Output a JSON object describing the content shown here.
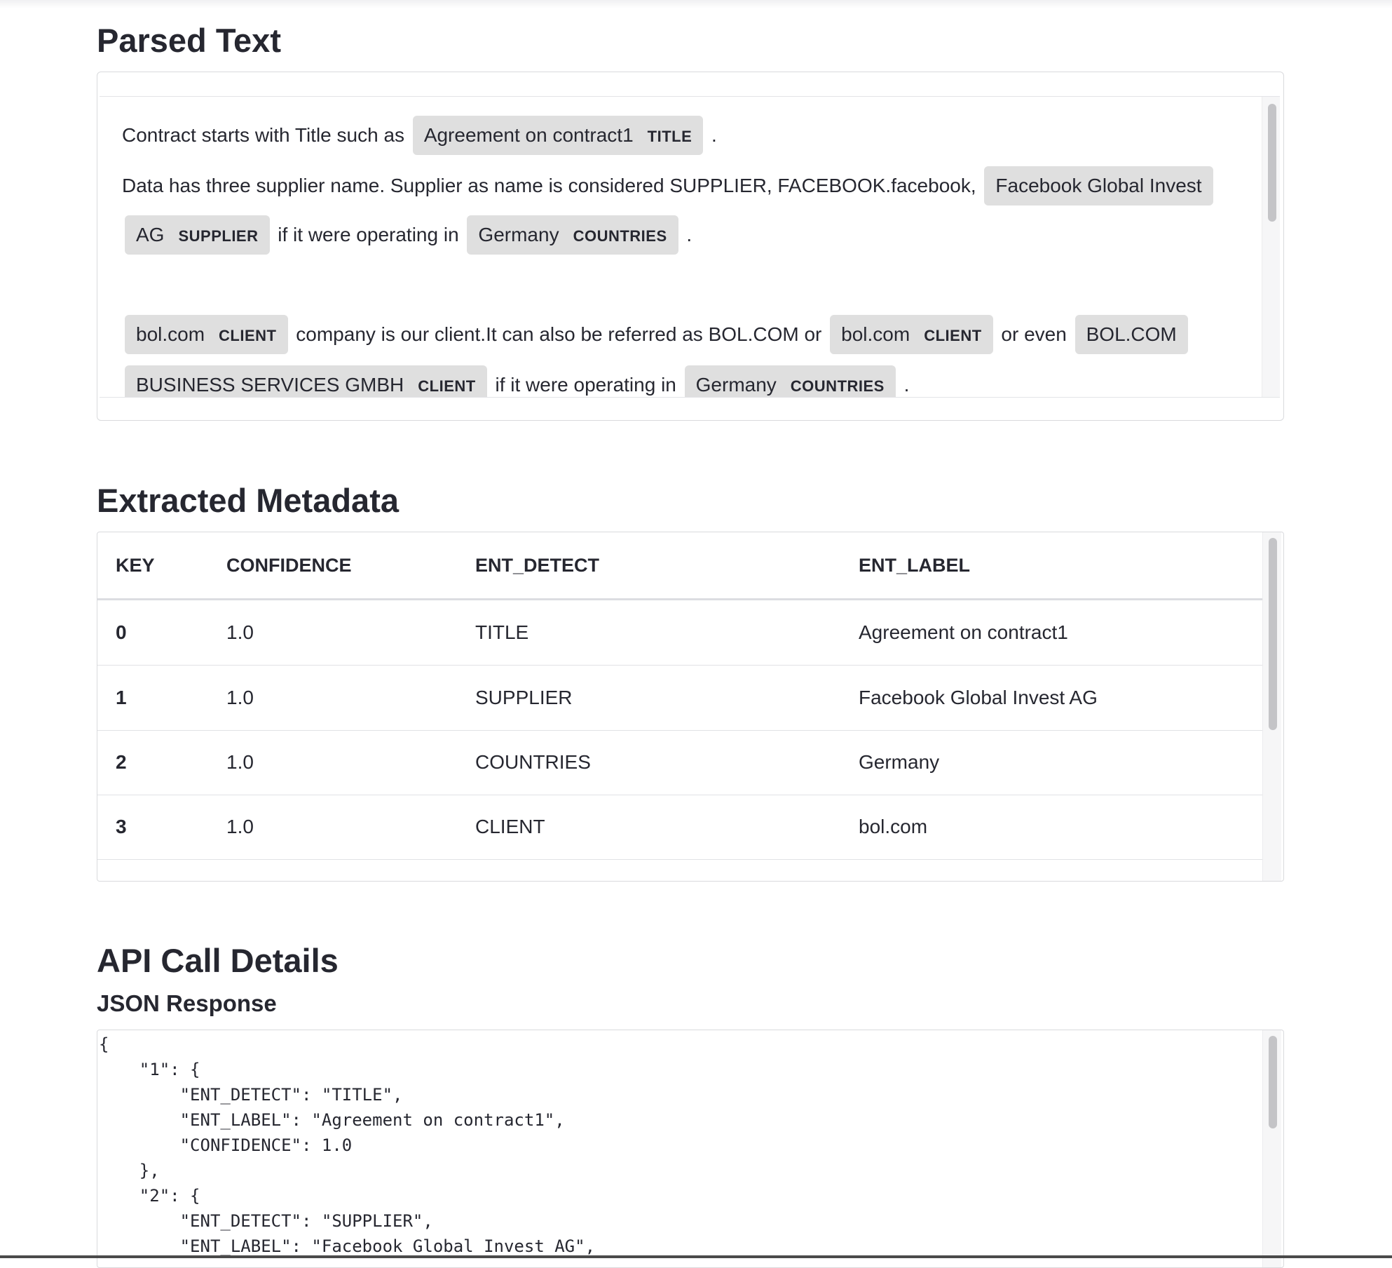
{
  "parsed_text": {
    "heading": "Parsed Text",
    "p1_text": "Contract starts with Title such as ",
    "p1_ent_text": "Agreement on contract1",
    "p1_ent_label": "TITLE",
    "p1_end": " .",
    "p2_text": "Data has three supplier name. Supplier as name is considered SUPPLIER, FACEBOOK.facebook, ",
    "p2_ent1_text": "Facebook Global Invest AG",
    "p2_ent1_label": "SUPPLIER",
    "p2_mid": " if it were operating in ",
    "p2_ent2_text": "Germany",
    "p2_ent2_label": "COUNTRIES",
    "p2_end": " .",
    "p3_ent1_text": "bol.com",
    "p3_ent1_label": "CLIENT",
    "p3_text1": " company is our client.It can also be referred as BOL.COM or ",
    "p3_ent2_text": "bol.com",
    "p3_ent2_label": "CLIENT",
    "p3_text2": " or even ",
    "p3_ent3_text": "BOL.COM BUSINESS SERVICES GMBH",
    "p3_ent3_label": "CLIENT",
    "p3_text3": " if it were operating in ",
    "p3_ent4_text": "Germany",
    "p3_ent4_label": "COUNTRIES",
    "p3_end": " ."
  },
  "metadata": {
    "heading": "Extracted Metadata",
    "columns": [
      "KEY",
      "CONFIDENCE",
      "ENT_DETECT",
      "ENT_LABEL"
    ],
    "rows": [
      [
        "0",
        "1.0",
        "TITLE",
        "Agreement on contract1"
      ],
      [
        "1",
        "1.0",
        "SUPPLIER",
        "Facebook Global Invest AG"
      ],
      [
        "2",
        "1.0",
        "COUNTRIES",
        "Germany"
      ],
      [
        "3",
        "1.0",
        "CLIENT",
        "bol.com"
      ]
    ]
  },
  "api": {
    "heading": "API Call Details",
    "subheading": "JSON Response",
    "json_text": "{\n    \"1\": {\n        \"ENT_DETECT\": \"TITLE\",\n        \"ENT_LABEL\": \"Agreement on contract1\",\n        \"CONFIDENCE\": 1.0\n    },\n    \"2\": {\n        \"ENT_DETECT\": \"SUPPLIER\",\n        \"ENT_LABEL\": \"Facebook Global Invest AG\","
  }
}
